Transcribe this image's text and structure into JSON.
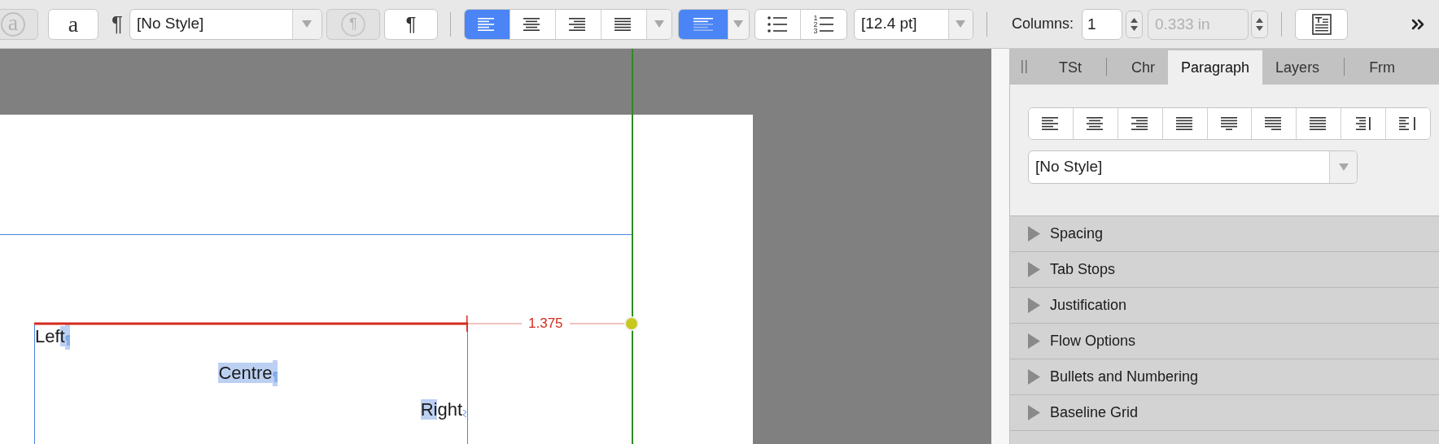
{
  "toolbar": {
    "char_style_buttons": [
      {
        "glyph": "a",
        "disabled": true
      },
      {
        "glyph": "a",
        "disabled": false
      }
    ],
    "para_mark": "¶",
    "style_select": {
      "value": "[No Style]"
    },
    "para_style_buttons": [
      {
        "glyph": "¶",
        "disabled": true
      },
      {
        "glyph": "¶",
        "disabled": false
      }
    ],
    "alignment_buttons": [
      {
        "kind": "left",
        "selected": true
      },
      {
        "kind": "center",
        "selected": false
      },
      {
        "kind": "right",
        "selected": false
      },
      {
        "kind": "justify",
        "selected": false
      }
    ],
    "vertical_alignment": {
      "selected": true
    },
    "list_buttons": [
      {
        "kind": "bullets"
      },
      {
        "kind": "numbered",
        "numerals": [
          "1",
          "2",
          "3"
        ]
      }
    ],
    "leading_select": {
      "value": "[12.4 pt]"
    },
    "columns": {
      "label": "Columns:",
      "value": "1",
      "gutter": "0.333 in",
      "gutter_disabled": true
    }
  },
  "document": {
    "lines": [
      {
        "kind": "left",
        "end_mark": {
          "kind": "pilcrow"
        },
        "segments": [
          {
            "text": "Lef",
            "selected": false
          },
          {
            "text": "t",
            "selected": true
          }
        ]
      },
      {
        "kind": "center",
        "end_mark": {
          "kind": "pilcrow"
        },
        "segments": [
          {
            "text": "Centre",
            "selected": true
          }
        ]
      },
      {
        "kind": "right",
        "end_mark": {
          "kind": "story-end"
        },
        "segments": [
          {
            "text": "Ri",
            "selected": true
          },
          {
            "text": "ght",
            "selected": false
          }
        ]
      }
    ],
    "measurement": {
      "label": "1.375"
    }
  },
  "panel": {
    "tabs": [
      {
        "label": "TSt",
        "selected": false
      },
      {
        "label": "Chr",
        "selected": false
      },
      {
        "label": "Paragraph",
        "selected": true
      },
      {
        "label": "Layers",
        "selected": false
      },
      {
        "label": "Frm",
        "selected": false
      }
    ],
    "alignment_buttons": [
      {
        "kind": "left",
        "selected": false
      },
      {
        "kind": "center",
        "selected": false
      },
      {
        "kind": "right",
        "selected": false
      },
      {
        "kind": "justify",
        "selected": false
      },
      {
        "kind": "justify-center",
        "selected": false
      },
      {
        "kind": "justify-right",
        "selected": false
      },
      {
        "kind": "justify-all",
        "selected": false
      },
      {
        "kind": "toward-spine",
        "selected": false
      },
      {
        "kind": "away-spine",
        "selected": false
      }
    ],
    "style_select": {
      "value": "[No Style]"
    },
    "sections": [
      {
        "label": "Spacing",
        "expanded": false
      },
      {
        "label": "Tab Stops",
        "expanded": false
      },
      {
        "label": "Justification",
        "expanded": false
      },
      {
        "label": "Flow Options",
        "expanded": false
      },
      {
        "label": "Bullets and Numbering",
        "expanded": false
      },
      {
        "label": "Baseline Grid",
        "expanded": false
      }
    ]
  }
}
